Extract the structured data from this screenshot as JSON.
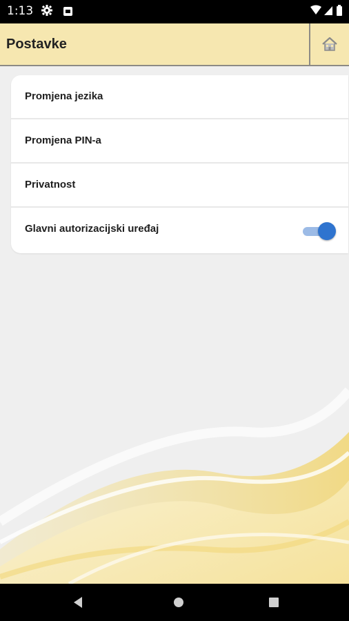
{
  "status_bar": {
    "time": "1:13",
    "icons": [
      "settings-gear-icon",
      "notification-square-icon",
      "wifi-icon",
      "signal-icon",
      "battery-icon"
    ]
  },
  "app_bar": {
    "title": "Postavke",
    "home_icon": "home-icon",
    "background": "#f6e7b0"
  },
  "settings": {
    "items": [
      {
        "label": "Promjena jezika"
      },
      {
        "label": "Promjena PIN-a"
      },
      {
        "label": "Privatnost"
      },
      {
        "label": "Glavni autorizacijski uređaj",
        "toggle": true,
        "toggle_on": true
      }
    ]
  },
  "toggle_colors": {
    "thumb": "#2f74cf",
    "track": "#9cbbe6"
  },
  "nav_bar": {
    "buttons": [
      "back-triangle-icon",
      "home-circle-icon",
      "recents-square-icon"
    ]
  }
}
